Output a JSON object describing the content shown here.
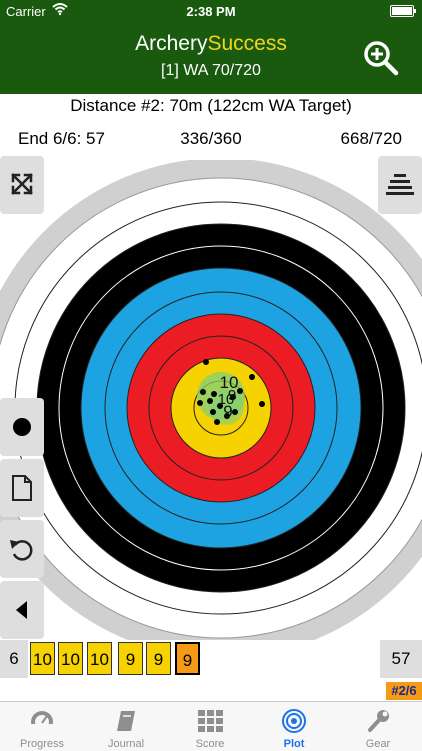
{
  "status_bar": {
    "carrier": "Carrier",
    "time": "2:38 PM"
  },
  "header": {
    "title_part1": "Archery",
    "title_part2": "Success",
    "subtitle": "[1] WA 70/720",
    "zoom_icon": "zoom-in-icon"
  },
  "distance": {
    "label": "Distance #2: 70m (122cm WA Target)"
  },
  "stats": {
    "end": "End 6/6: 57",
    "distance_score": "336/360",
    "total_score": "668/720"
  },
  "side_buttons": {
    "expand_icon": "expand-icon",
    "menu_icon": "stack-icon",
    "arrow_icon": "dot-icon",
    "note_icon": "document-icon",
    "undo_icon": "undo-icon",
    "back_icon": "triangle-left-icon"
  },
  "target": {
    "labels": [
      "10",
      "9",
      "10",
      "9"
    ]
  },
  "end_row": {
    "end_number": "6",
    "scores": [
      "10",
      "10",
      "10",
      "9",
      "9",
      "9"
    ],
    "selected_index": 5,
    "end_total": "57"
  },
  "badge": "#2/6",
  "tabs": [
    {
      "label": "Progress",
      "icon": "gauge-icon"
    },
    {
      "label": "Journal",
      "icon": "book-icon"
    },
    {
      "label": "Score",
      "icon": "grid-icon"
    },
    {
      "label": "Plot",
      "icon": "target-icon"
    },
    {
      "label": "Gear",
      "icon": "wrench-icon"
    }
  ],
  "active_tab": "Plot",
  "colors": {
    "header_green": "#1a5a0e",
    "title_accent": "#f0d41c",
    "ring_gold": "#f6d200",
    "ring_red": "#ec1c24",
    "ring_blue": "#1ea3e2",
    "ring_black": "#000000",
    "selected_score": "#f49a16",
    "active_tab": "#1a73e8"
  }
}
